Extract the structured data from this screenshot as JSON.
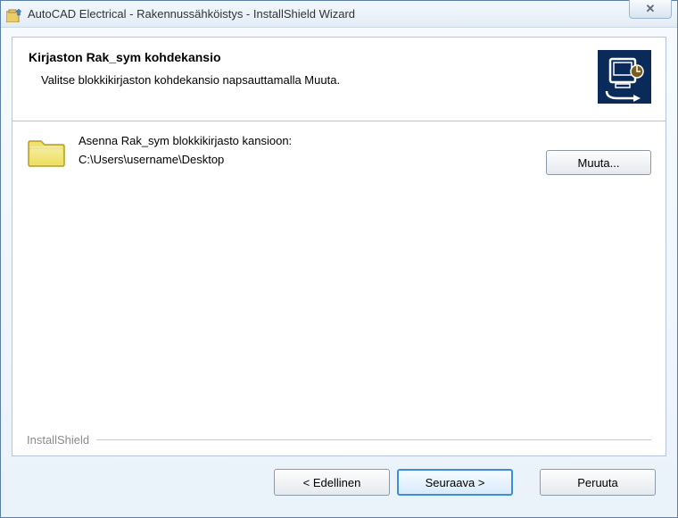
{
  "titlebar": {
    "title": "AutoCAD Electrical - Rakennussähköistys - InstallShield Wizard",
    "close_glyph": "✕"
  },
  "header": {
    "title": "Kirjaston Rak_sym kohdekansio",
    "subtitle": "Valitse blokkikirjaston kohdekansio napsauttamalla Muuta."
  },
  "body": {
    "install_label": "Asenna Rak_sym blokkikirjasto kansioon:",
    "install_path": "C:\\Users\\username\\Desktop",
    "change_label": "Muuta..."
  },
  "brand": "InstallShield",
  "footer": {
    "back": "< Edellinen",
    "next": "Seuraava >",
    "cancel": "Peruuta"
  }
}
